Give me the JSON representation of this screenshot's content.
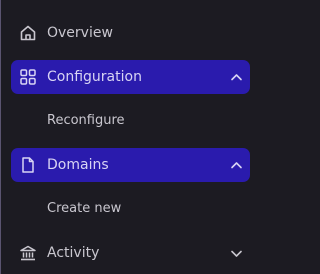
{
  "sidebar": {
    "items": [
      {
        "label": "Overview",
        "icon": "home-icon",
        "active": false
      },
      {
        "label": "Configuration",
        "icon": "grid-icon",
        "active": true,
        "expanded": true,
        "children": [
          {
            "label": "Reconfigure"
          }
        ]
      },
      {
        "label": "Domains",
        "icon": "file-icon",
        "active": true,
        "expanded": true,
        "children": [
          {
            "label": "Create new"
          }
        ]
      },
      {
        "label": "Activity",
        "icon": "bank-icon",
        "active": false,
        "expanded": false
      }
    ]
  },
  "colors": {
    "background": "#1c1b22",
    "active_bg": "#2a1bad",
    "text": "#c9c7cf"
  }
}
